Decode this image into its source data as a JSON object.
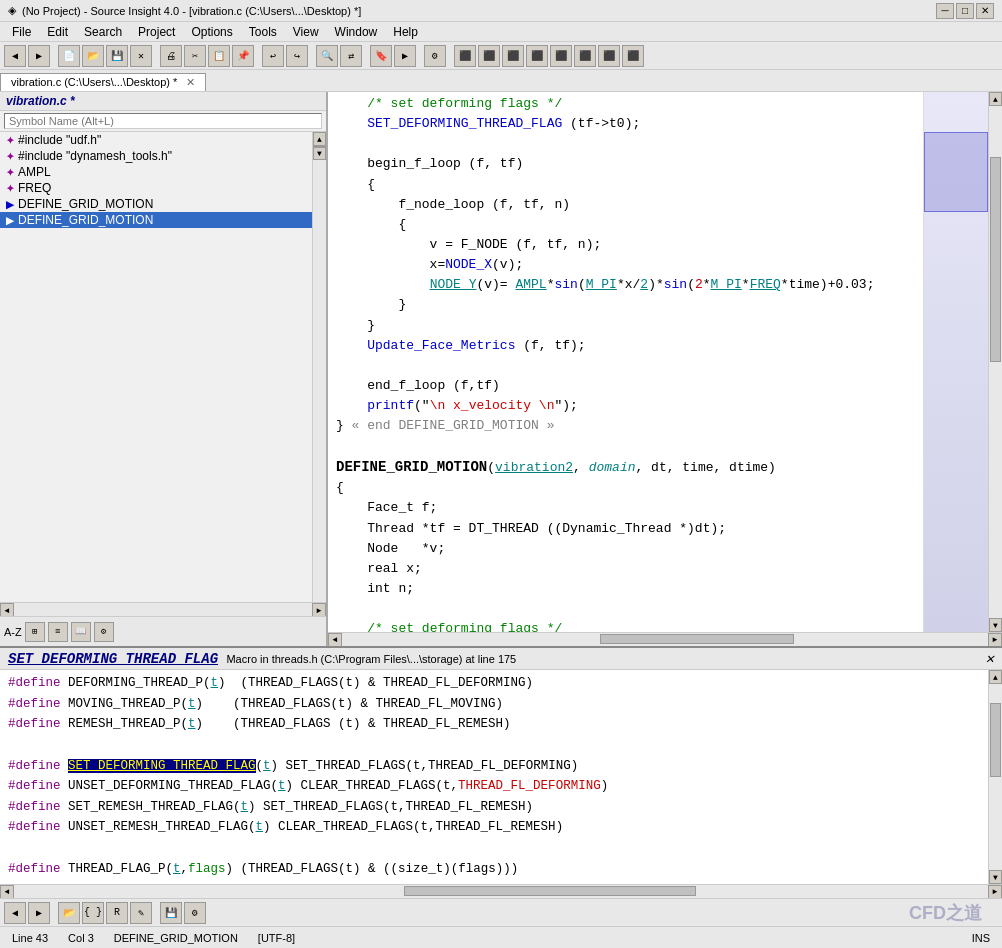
{
  "title_bar": {
    "text": "(No Project) - Source Insight 4.0 - [vibration.c (C:\\Users\\...\\Desktop) *]",
    "icon": "◈",
    "min": "─",
    "max": "□",
    "close": "✕",
    "restore": "❐"
  },
  "menu": {
    "items": [
      "File",
      "Edit",
      "Search",
      "Project",
      "Options",
      "Tools",
      "View",
      "Window",
      "Help"
    ]
  },
  "tab_bar": {
    "tabs": [
      {
        "label": "vibration.c (C:\\Users\\...\\Desktop) *",
        "active": true
      }
    ]
  },
  "left_panel": {
    "title": "vibration.c *",
    "search_placeholder": "Symbol Name (Alt+L)",
    "symbols": [
      {
        "icon": "✦",
        "type": "define",
        "name": "#include \"udf.h\""
      },
      {
        "icon": "✦",
        "type": "define",
        "name": "#include \"dynamesh_tools.h\""
      },
      {
        "icon": "✦",
        "type": "define",
        "name": "AMPL"
      },
      {
        "icon": "✦",
        "type": "define",
        "name": "FREQ"
      },
      {
        "icon": "▶",
        "type": "func",
        "name": "DEFINE_GRID_MOTION"
      },
      {
        "icon": "▶",
        "type": "func",
        "name": "DEFINE_GRID_MOTION",
        "selected": true
      }
    ]
  },
  "bottom_panel": {
    "title": "SET_DEFORMING_THREAD_FLAG",
    "subtitle": "Macro in threads.h (C:\\Program Files\\...\\storage) at line 175",
    "close_label": "✕"
  },
  "status_bar": {
    "line": "Line 43",
    "col": "Col 3",
    "symbol": "DEFINE_GRID_MOTION",
    "encoding": "[UTF-8]",
    "ins": "INS"
  },
  "colors": {
    "keyword": "#0000ff",
    "comment": "#008000",
    "highlight_bg": "#000080",
    "highlight_fg": "#ffffff",
    "define_name": "#cc0000",
    "teal": "#008080",
    "bottom_highlight_fg": "#ffff00"
  }
}
